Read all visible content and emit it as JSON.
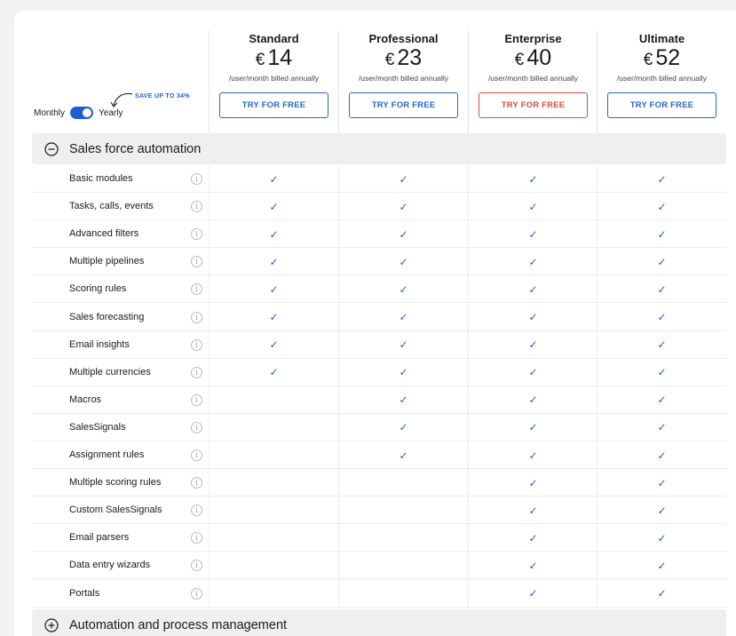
{
  "plans": [
    {
      "name": "Standard",
      "currency": "€",
      "price": "14",
      "billing": "/user/month billed annually",
      "cta": "TRY FOR FREE",
      "highlight": false
    },
    {
      "name": "Professional",
      "currency": "€",
      "price": "23",
      "billing": "/user/month billed annually",
      "cta": "TRY FOR FREE",
      "highlight": false
    },
    {
      "name": "Enterprise",
      "currency": "€",
      "price": "40",
      "billing": "/user/month billed annually",
      "cta": "TRY FOR FREE",
      "highlight": true
    },
    {
      "name": "Ultimate",
      "currency": "€",
      "price": "52",
      "billing": "/user/month billed annually",
      "cta": "TRY FOR FREE",
      "highlight": false
    }
  ],
  "billing_toggle": {
    "left_label": "Monthly",
    "right_label": "Yearly",
    "selected": "Yearly",
    "save_note": "SAVE UP TO 34%"
  },
  "sections": [
    {
      "title": "Sales force automation",
      "expanded": true,
      "icon": "minus-circle-icon"
    },
    {
      "title": "Automation and process management",
      "expanded": false,
      "icon": "plus-circle-icon"
    }
  ],
  "features": [
    {
      "name": "Basic modules",
      "plans": [
        true,
        true,
        true,
        true
      ]
    },
    {
      "name": "Tasks, calls, events",
      "plans": [
        true,
        true,
        true,
        true
      ]
    },
    {
      "name": "Advanced filters",
      "plans": [
        true,
        true,
        true,
        true
      ]
    },
    {
      "name": "Multiple pipelines",
      "plans": [
        true,
        true,
        true,
        true
      ]
    },
    {
      "name": "Scoring rules",
      "plans": [
        true,
        true,
        true,
        true
      ]
    },
    {
      "name": "Sales forecasting",
      "plans": [
        true,
        true,
        true,
        true
      ]
    },
    {
      "name": "Email insights",
      "plans": [
        true,
        true,
        true,
        true
      ]
    },
    {
      "name": "Multiple currencies",
      "plans": [
        true,
        true,
        true,
        true
      ]
    },
    {
      "name": "Macros",
      "plans": [
        false,
        true,
        true,
        true
      ]
    },
    {
      "name": "SalesSignals",
      "plans": [
        false,
        true,
        true,
        true
      ]
    },
    {
      "name": "Assignment rules",
      "plans": [
        false,
        true,
        true,
        true
      ]
    },
    {
      "name": "Multiple scoring rules",
      "plans": [
        false,
        false,
        true,
        true
      ]
    },
    {
      "name": "Custom SalesSignals",
      "plans": [
        false,
        false,
        true,
        true
      ]
    },
    {
      "name": "Email parsers",
      "plans": [
        false,
        false,
        true,
        true
      ]
    },
    {
      "name": "Data entry wizards",
      "plans": [
        false,
        false,
        true,
        true
      ]
    },
    {
      "name": "Portals",
      "plans": [
        false,
        false,
        true,
        true
      ]
    }
  ],
  "check_glyph": "✓",
  "info_glyph": "i",
  "colors": {
    "accent": "#1d5fd6",
    "cta_highlight": "#e04a3f",
    "section_bg": "#efefef"
  }
}
